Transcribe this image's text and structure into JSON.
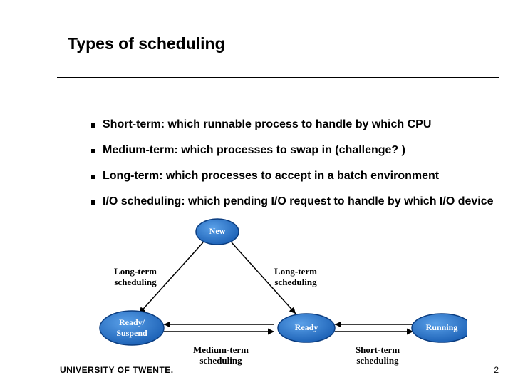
{
  "title": "Types of scheduling",
  "bullets": [
    "Short-term: which runnable process to handle by which CPU",
    "Medium-term: which processes to swap in (challenge? )",
    "Long-term: which processes to accept  in a batch environment",
    "I/O scheduling: which pending I/O request to handle by which I/O device"
  ],
  "diagram": {
    "nodes": {
      "new": "New",
      "ready_suspend_1": "Ready/",
      "ready_suspend_2": "Suspend",
      "ready": "Ready",
      "running": "Running"
    },
    "edges": {
      "long_term_left": "Long-term",
      "long_term_right": "Long-term",
      "scheduling": "scheduling",
      "medium_term": "Medium-term",
      "short_term": "Short-term"
    }
  },
  "footer": "UNIVERSITY OF TWENTE.",
  "page": "2"
}
